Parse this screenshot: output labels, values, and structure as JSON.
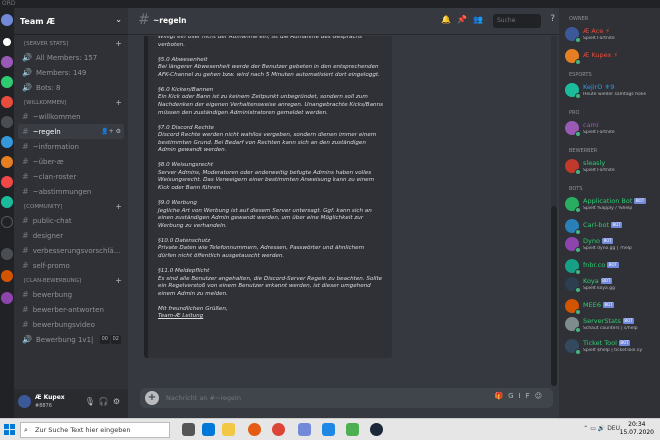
{
  "titlebar": {
    "text": "ORD"
  },
  "server": {
    "name": "Team Æ"
  },
  "categories": [
    {
      "label": "[SERVER STATS]",
      "channels": [
        "All Members: 157",
        "Members: 149",
        "Bots: 8"
      ]
    },
    {
      "label": "[WILLKOMMEN]",
      "channels": [
        "~willkommen",
        "~regeln",
        "~information",
        "~über-æ",
        "~clan-roster",
        "~abstimmungen"
      ]
    },
    {
      "label": "[COMMUNITY]",
      "channels": [
        "public-chat",
        "designer",
        "verbesserungsvorschlä...",
        "self-promo"
      ]
    },
    {
      "label": "[CLAN-BEWERBUNG]",
      "channels": [
        "bewerbung",
        "bewerber-antworten",
        "bewerbungsvideo",
        "Bewerbung 1v1|"
      ]
    }
  ],
  "voice_badges": {
    "a": "00",
    "b": "02"
  },
  "user": {
    "name": "Æ Kupex",
    "tag": "#8876"
  },
  "channel": {
    "name": "~regeln"
  },
  "search_placeholder": "Suche",
  "composer_placeholder": "Nachricht an #~regeln",
  "embed": {
    "intro": "Willigt ein User nicht der Aufnahme ein, ist die Aufnahme des Gesprächs verboten.",
    "sections": [
      {
        "head": "§5.0 Abwesenheit",
        "body": "Bei längerer Abwesenheit werde der Benutzer gebeten in den entsprechenden AFK-Channel zu gehen bzw. wird nach 5 Minuten automatisiert dort eingeloggt."
      },
      {
        "head": "§6.0 Kicken/Bannen",
        "body": "Ein Kick oder Bann ist zu keinem Zeitpunkt unbegründet, sondern soll zum Nachdenken der eigenen Verhaltensweise anregen. Unangebrachte Kicks/Banns müssen den zuständigen Administratoren gemeldet werden."
      },
      {
        "head": "§7.0 Discord Rechte",
        "body": "Discord Rechte werden nicht wahllos vergeben, sondern dienen immer einem bestimmten Grund. Bei Bedarf von Rechten kann sich an den zuständigen Admin gewandt werden."
      },
      {
        "head": "§8.0 Weisungsrecht",
        "body": "Server Admins, Moderatoren oder anderweitig befugte Admins haben volles Weisungsrecht. Das Verweigern einer bestimmten Anweisung kann zu einem Kick oder Bann führen."
      },
      {
        "head": "§9.0 Werbung",
        "body": "Jegliche Art von Werbung ist auf diesem Server untersagt. Ggf. kann sich an einen zuständigen Admin gewandt werden, um über eine Möglichkeit zur Werbung zu verhandeln."
      },
      {
        "head": "§10.0 Datenschutz",
        "body": "Private Daten wie Telefonnummern, Adressen, Passwörter und ähnlichem dürfen nicht öffentlich ausgetauscht werden."
      },
      {
        "head": "§11.0 Meldepflicht",
        "body": "Es sind alle Benutzer angehalten, die Discord-Server Regeln zu beachten. Sollte ein Regelverstoß von einem Benutzer erkannt werden, ist dieser umgehend einem Admin zu melden."
      }
    ],
    "closing": "Mit freundlichen Grüßen,",
    "signature": "Team-Æ Leitung"
  },
  "reaction": "✓",
  "member_groups": [
    {
      "label": "OWNER",
      "members": [
        {
          "name": "Æ Ace ⚡",
          "status": "Spielt Fortnite",
          "color": "#e74c3c",
          "bot": false
        },
        {
          "name": "Æ Kupex ⚡",
          "status": "",
          "color": "#e74c3c",
          "bot": false
        }
      ]
    },
    {
      "label": "ESPORTS",
      "members": [
        {
          "name": "KejirO ⚜9",
          "status": "Heute wieder samtags holie",
          "color": "#3498db",
          "bot": false
        }
      ]
    },
    {
      "label": "PRO",
      "members": [
        {
          "name": "cami",
          "status": "Spielt Fortnite",
          "color": "#9b59b6",
          "bot": false
        }
      ]
    },
    {
      "label": "BEWERBER",
      "members": [
        {
          "name": "sleasly",
          "status": "Spielt Fortnite",
          "color": "#2ecc71",
          "bot": false
        }
      ]
    },
    {
      "label": "BOTS",
      "members": [
        {
          "name": "Application Bot",
          "status": "Spielt %apply / %help",
          "color": "#2ecc71",
          "bot": true
        },
        {
          "name": "Carl-bot",
          "status": "",
          "color": "#2ecc71",
          "bot": true
        },
        {
          "name": "Dyno",
          "status": "Spielt dyno.gg | ?help",
          "color": "#2ecc71",
          "bot": true
        },
        {
          "name": "fnbr.co",
          "status": "",
          "color": "#2ecc71",
          "bot": true
        },
        {
          "name": "Koya",
          "status": "Spielt koya.gg",
          "color": "#2ecc71",
          "bot": true
        },
        {
          "name": "MEE6",
          "status": "",
          "color": "#2ecc71",
          "bot": true
        },
        {
          "name": "ServerStats",
          "status": "Schaut counters | s/help",
          "color": "#2ecc71",
          "bot": true
        },
        {
          "name": "Ticket Tool",
          "status": "Spielt $help | ticketTool.xy",
          "color": "#2ecc71",
          "bot": true
        }
      ]
    }
  ],
  "bot_label": "BOT",
  "taskbar": {
    "search": "Zur Suche Text hier eingeben",
    "lang": "DEU",
    "time": "20:34",
    "date": "15.07.2020"
  }
}
